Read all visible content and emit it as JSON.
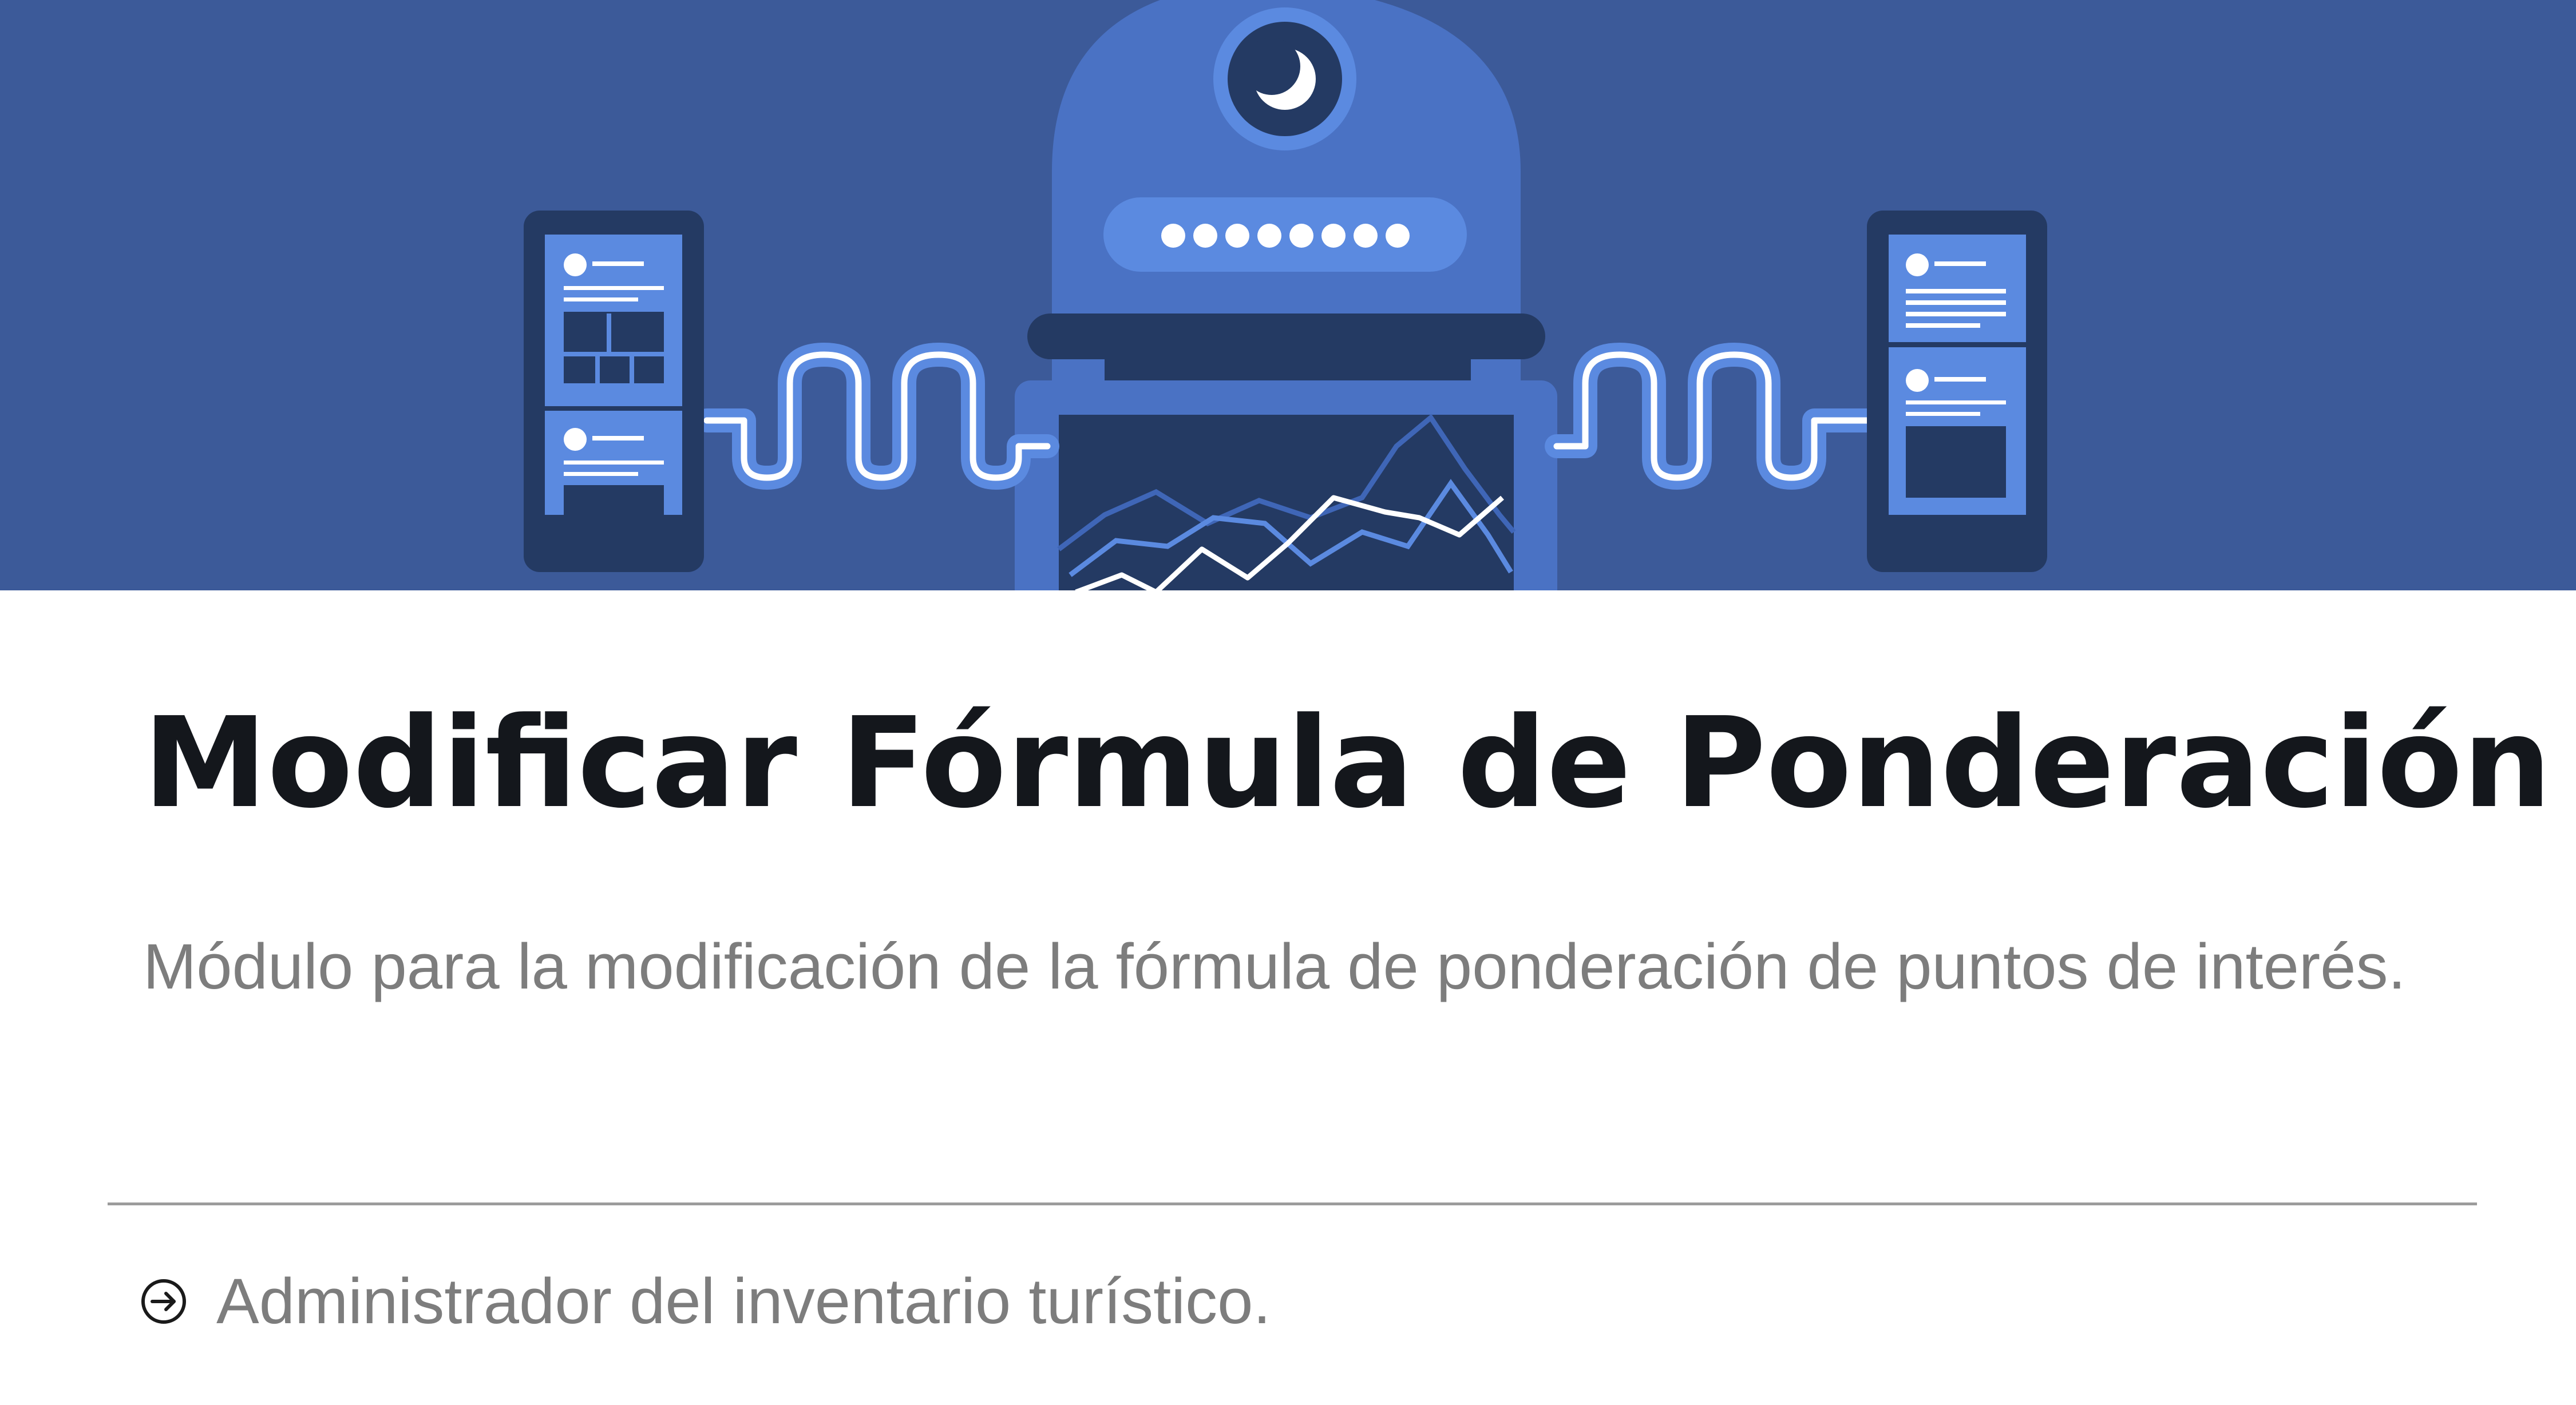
{
  "card": {
    "title": "Modificar Fórmula de Ponderación",
    "description": "Módulo para la modificación de la fórmula de ponderación de puntos de interés.",
    "audience": {
      "icon": "arrow-right-circle-icon",
      "text": "Administrador del inventario turístico."
    }
  },
  "banner": {
    "illustration": "robot-with-phones-illustration",
    "colors": {
      "background": "#3c5a99",
      "robot": "#4a72c4",
      "device_dark": "#243a63",
      "panel": "#5b8ae0",
      "glow": "#ffffff"
    }
  }
}
